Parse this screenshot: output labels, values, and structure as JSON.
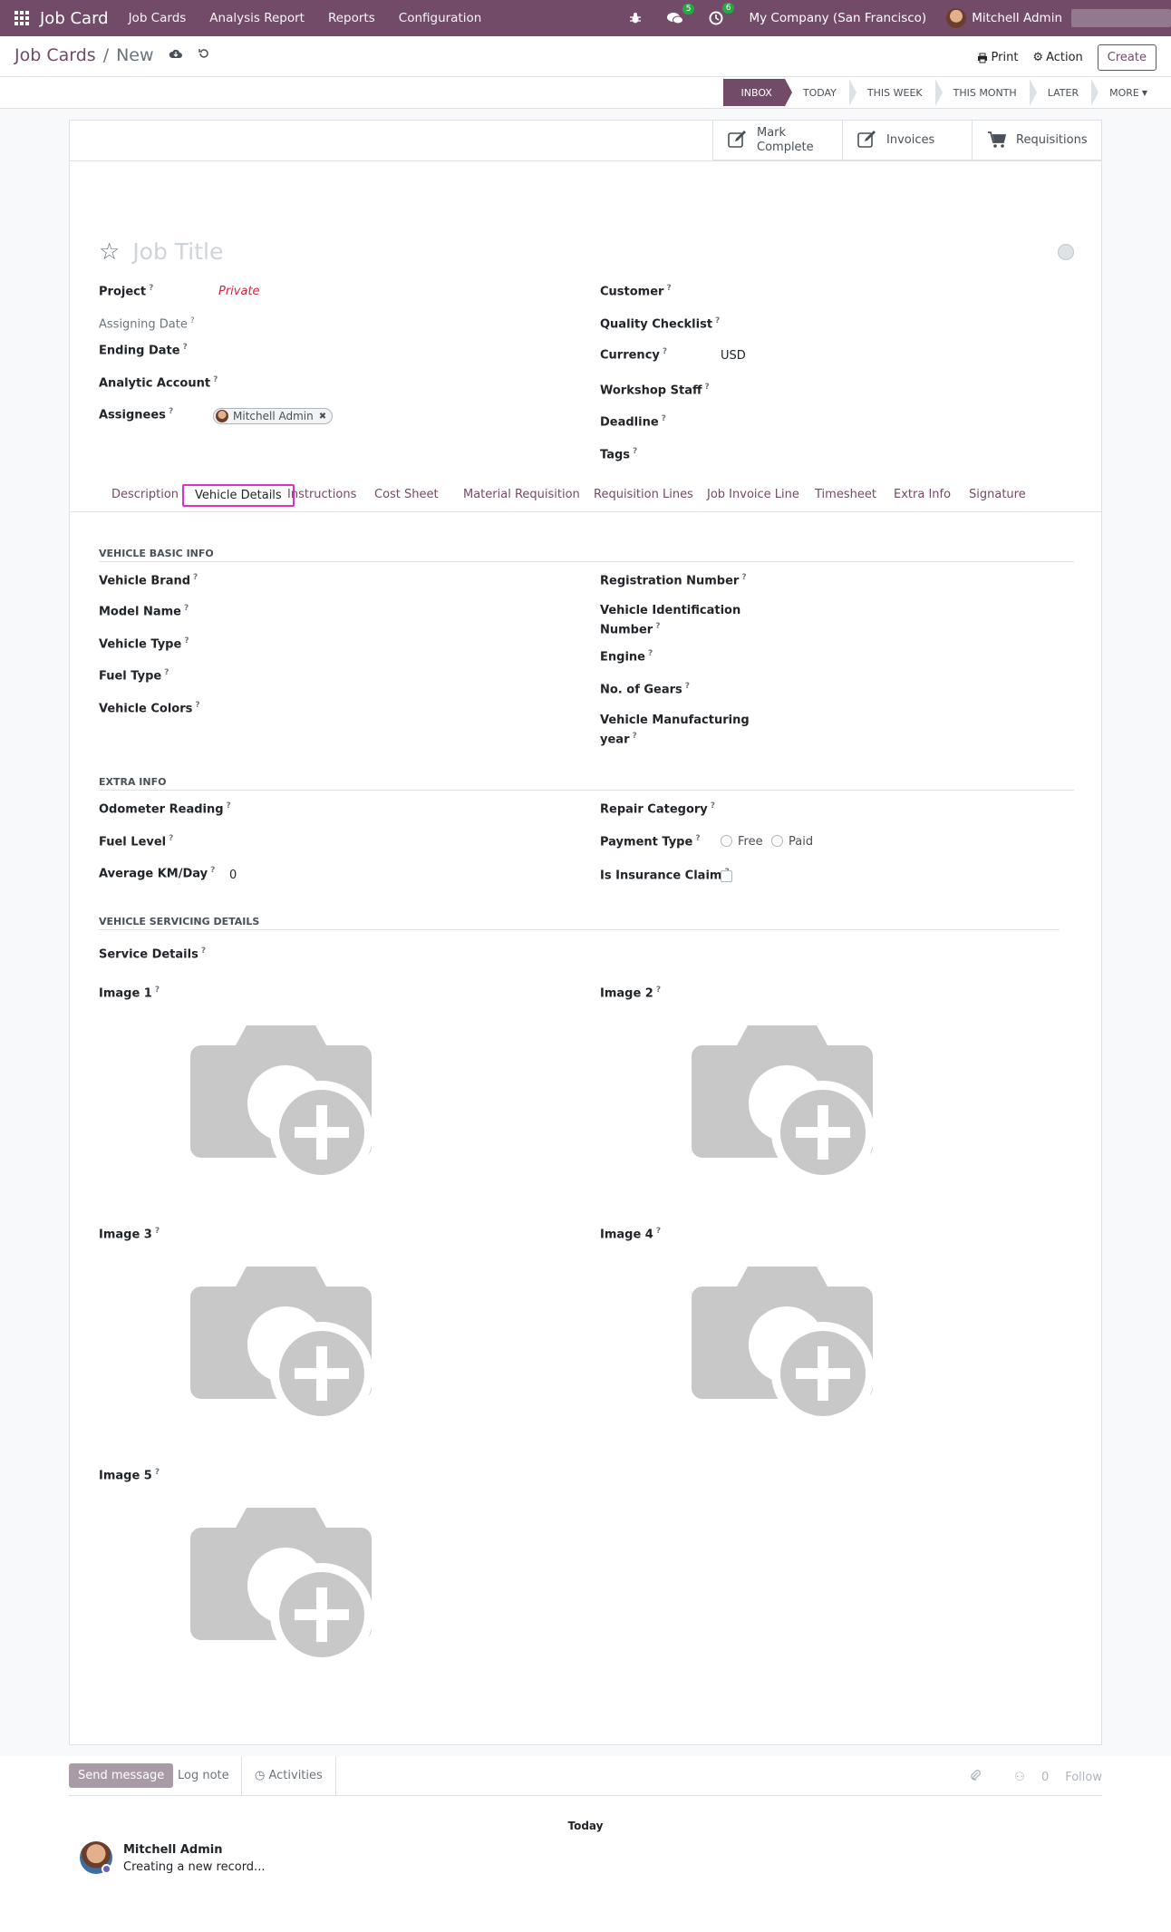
{
  "navbar": {
    "app_name": "Job Card",
    "menu": [
      "Job Cards",
      "Analysis Report",
      "Reports",
      "Configuration"
    ],
    "messages_count": "5",
    "activities_count": "6",
    "company": "My Company (San Francisco)",
    "user": "Mitchell Admin",
    "brand_color": "#714b67"
  },
  "breadcrumb": {
    "parent": "Job Cards",
    "current": "New"
  },
  "actions": {
    "print": "Print",
    "action": "Action",
    "create": "Create"
  },
  "stages": [
    "INBOX",
    "TODAY",
    "THIS WEEK",
    "THIS MONTH",
    "LATER",
    "MORE"
  ],
  "button_box": {
    "mark_complete": "Mark Complete",
    "invoices": "Invoices",
    "requisitions": "Requisitions"
  },
  "form": {
    "title_placeholder": "Job Title",
    "project_label": "Project",
    "project_value": "Private",
    "assigning_date_label": "Assigning Date",
    "ending_date_label": "Ending Date",
    "analytic_account_label": "Analytic Account",
    "assignees_label": "Assignees",
    "assignee": "Mitchell Admin",
    "customer_label": "Customer",
    "quality_checklist_label": "Quality Checklist",
    "currency_label": "Currency",
    "currency_value": "USD",
    "workshop_staff_label": "Workshop Staff",
    "deadline_label": "Deadline",
    "tags_label": "Tags"
  },
  "tabs": [
    "Description",
    "Vehicle Details",
    "Instructions",
    "Cost Sheet",
    "Material Requisition",
    "Requisition Lines",
    "Job Invoice Line",
    "Timesheet",
    "Extra Info",
    "Signature"
  ],
  "vehicle": {
    "basic_header": "VEHICLE BASIC INFO",
    "brand": "Vehicle Brand",
    "model": "Model Name",
    "type": "Vehicle Type",
    "fuel_type": "Fuel Type",
    "colors": "Vehicle Colors",
    "registration": "Registration Number",
    "vin_line1": "Vehicle Identification",
    "vin_line2": "Number",
    "engine": "Engine",
    "gears": "No. of Gears",
    "mfg_line1": "Vehicle Manufacturing",
    "mfg_line2": "year",
    "extra_header": "EXTRA INFO",
    "odometer": "Odometer Reading",
    "fuel_level": "Fuel Level",
    "avg_km": "Average KM/Day",
    "avg_km_value": "0",
    "repair_category": "Repair Category",
    "payment_type": "Payment Type",
    "payment_free": "Free",
    "payment_paid": "Paid",
    "insurance": "Is Insurance Claim",
    "servicing_header": "VEHICLE SERVICING DETAILS",
    "service_details": "Service Details",
    "image1": "Image 1",
    "image2": "Image 2",
    "image3": "Image 3",
    "image4": "Image 4",
    "image5": "Image 5"
  },
  "chatter": {
    "send_message": "Send message",
    "log_note": "Log note",
    "activities": "Activities",
    "attachments_count": "0",
    "follow": "Follow",
    "date_separator": "Today",
    "author": "Mitchell Admin",
    "message": "Creating a new record..."
  }
}
